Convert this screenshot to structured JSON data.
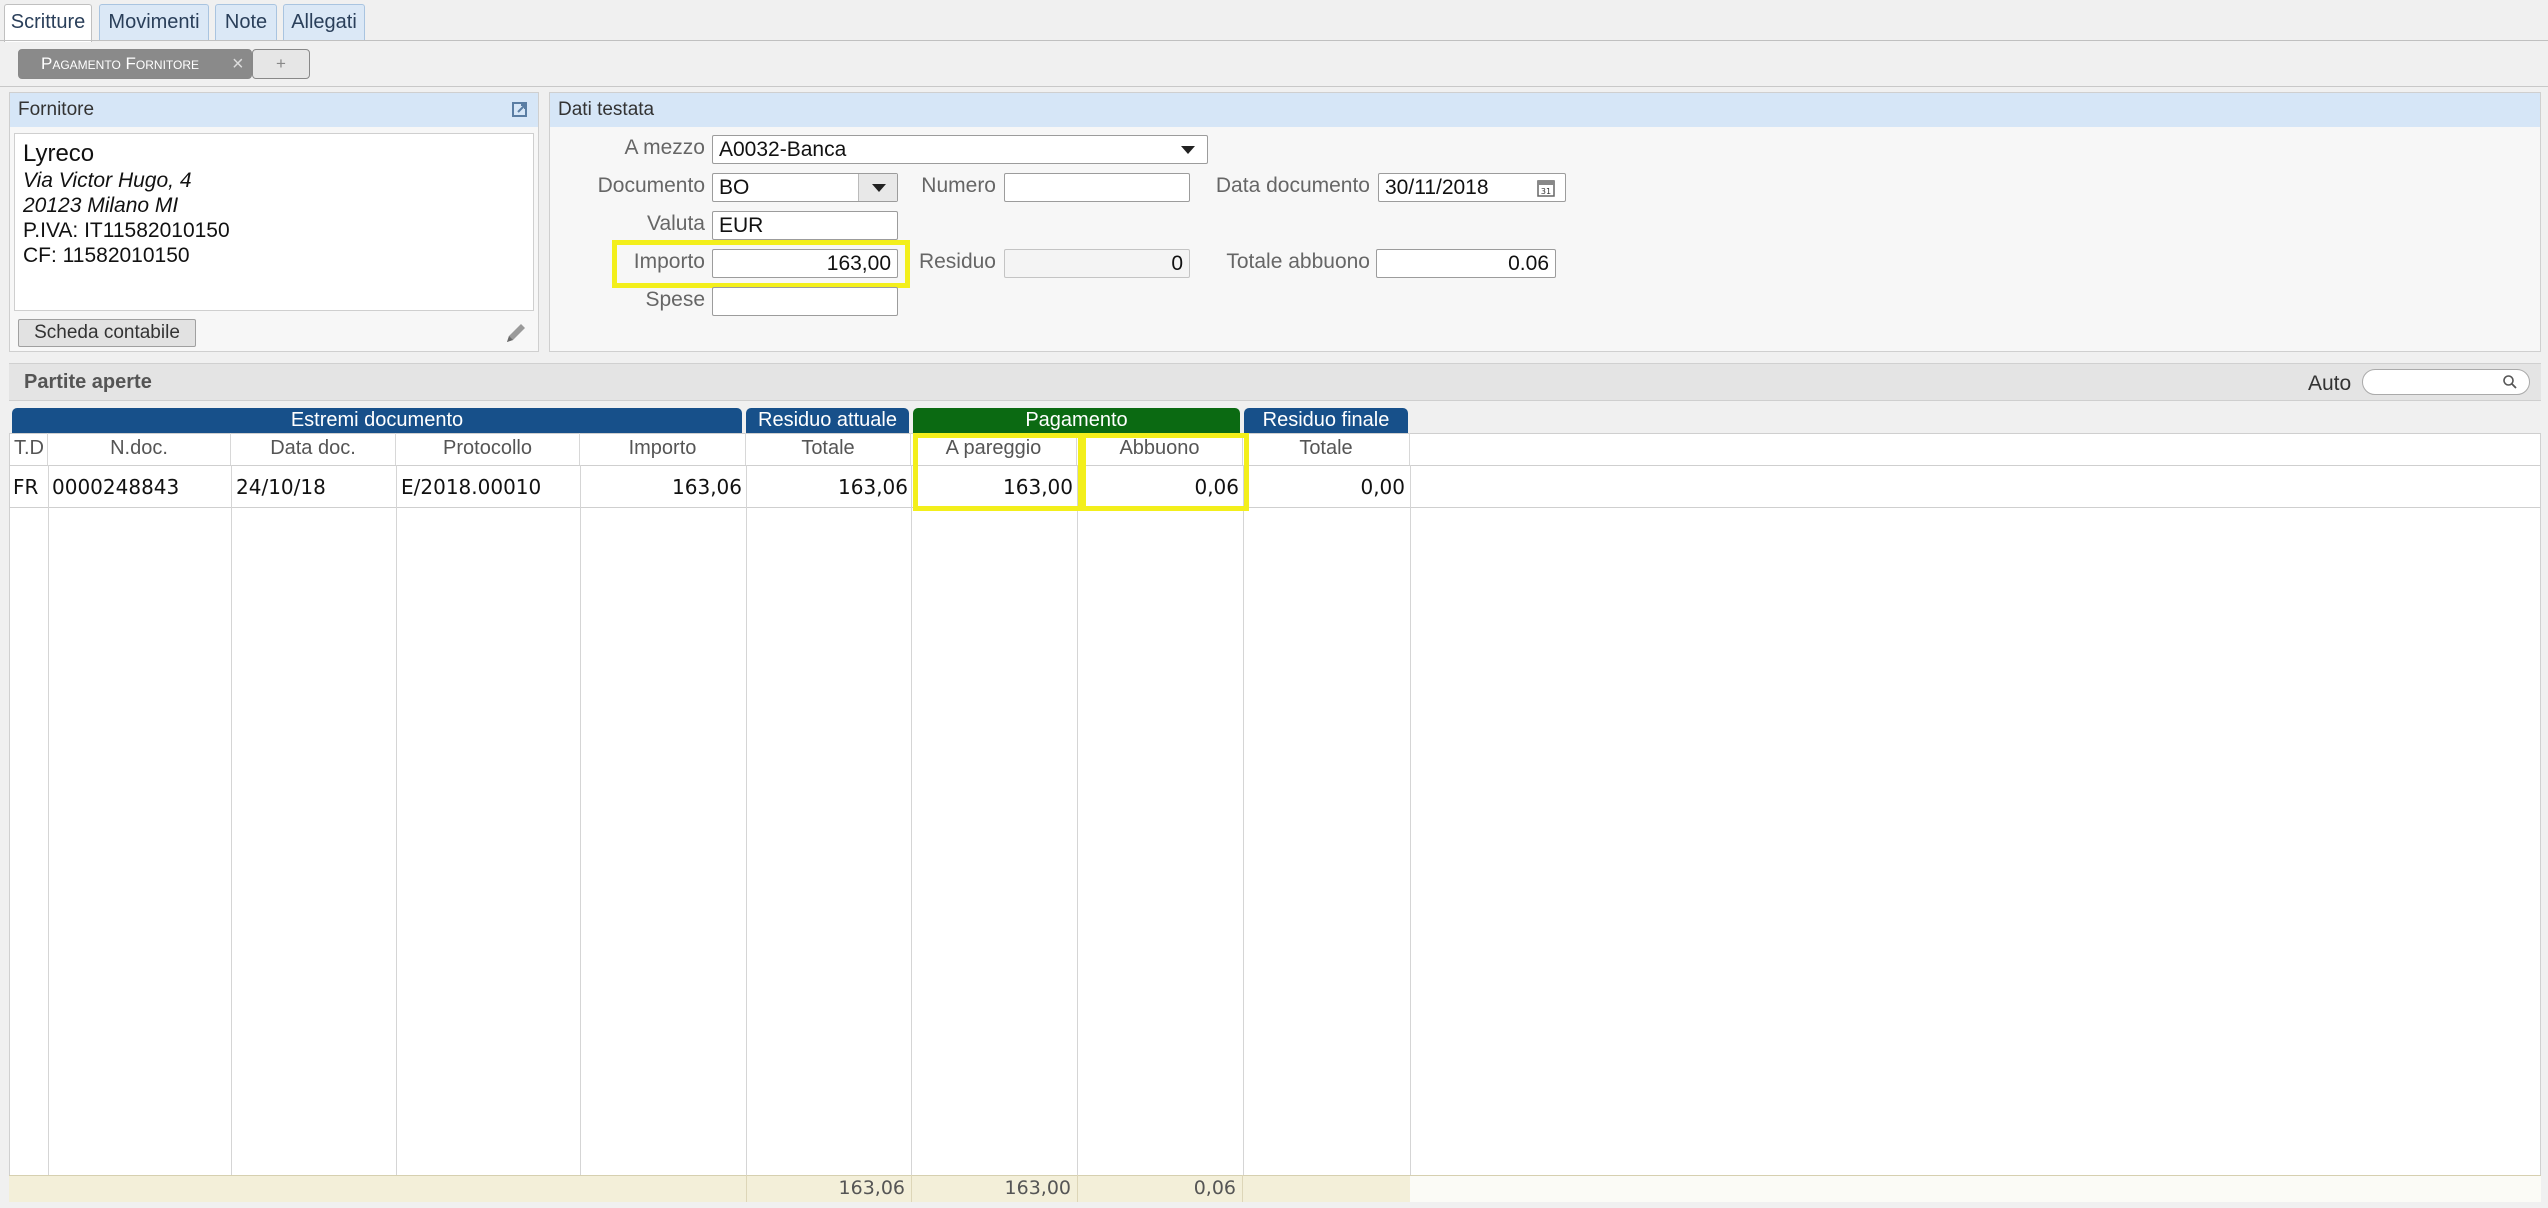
{
  "tabs": [
    "Scritture",
    "Movimenti",
    "Note",
    "Allegati"
  ],
  "subtabs": {
    "active": "Pagamento Fornitore",
    "close": "×",
    "add": "+"
  },
  "fornitore": {
    "title": "Fornitore",
    "name": "Lyreco",
    "address": "Via Victor Hugo, 4",
    "city": "20123 Milano  MI",
    "piva": "P.IVA: IT11582010150",
    "cf": "CF: 11582010150",
    "button": "Scheda contabile"
  },
  "testata": {
    "title": "Dati testata",
    "a_mezzo": {
      "label": "A mezzo",
      "value": "A0032-Banca"
    },
    "documento": {
      "label": "Documento",
      "value": "BO"
    },
    "numero": {
      "label": "Numero",
      "value": ""
    },
    "data_documento": {
      "label": "Data documento",
      "value": "30/11/2018"
    },
    "valuta": {
      "label": "Valuta",
      "value": "EUR"
    },
    "importo": {
      "label": "Importo",
      "value": "163,00"
    },
    "residuo": {
      "label": "Residuo",
      "value": "0"
    },
    "totale_abbuono": {
      "label": "Totale abbuono",
      "value": "0.06"
    },
    "spese": {
      "label": "Spese",
      "value": ""
    }
  },
  "partite": {
    "title": "Partite aperte",
    "auto_label": "Auto",
    "groups": [
      "Estremi documento",
      "Residuo attuale",
      "Pagamento",
      "Residuo finale"
    ],
    "columns": [
      "T.D",
      "N.doc.",
      "Data doc.",
      "Protocollo",
      "Importo",
      "Totale",
      "A pareggio",
      "Abbuono",
      "Totale"
    ],
    "rows": [
      [
        "FR",
        "0000248843",
        "24/10/18",
        "E/2018.00010",
        "163,06",
        "163,06",
        "163,00",
        "0,06",
        "0,00"
      ]
    ],
    "totals": {
      "residuo": "163,06",
      "pareggio": "163,00",
      "abbuono": "0,06"
    }
  },
  "colors": {
    "group_blue": "#17508a",
    "group_green": "#0b6a12",
    "highlight": "#f3ef1b"
  }
}
